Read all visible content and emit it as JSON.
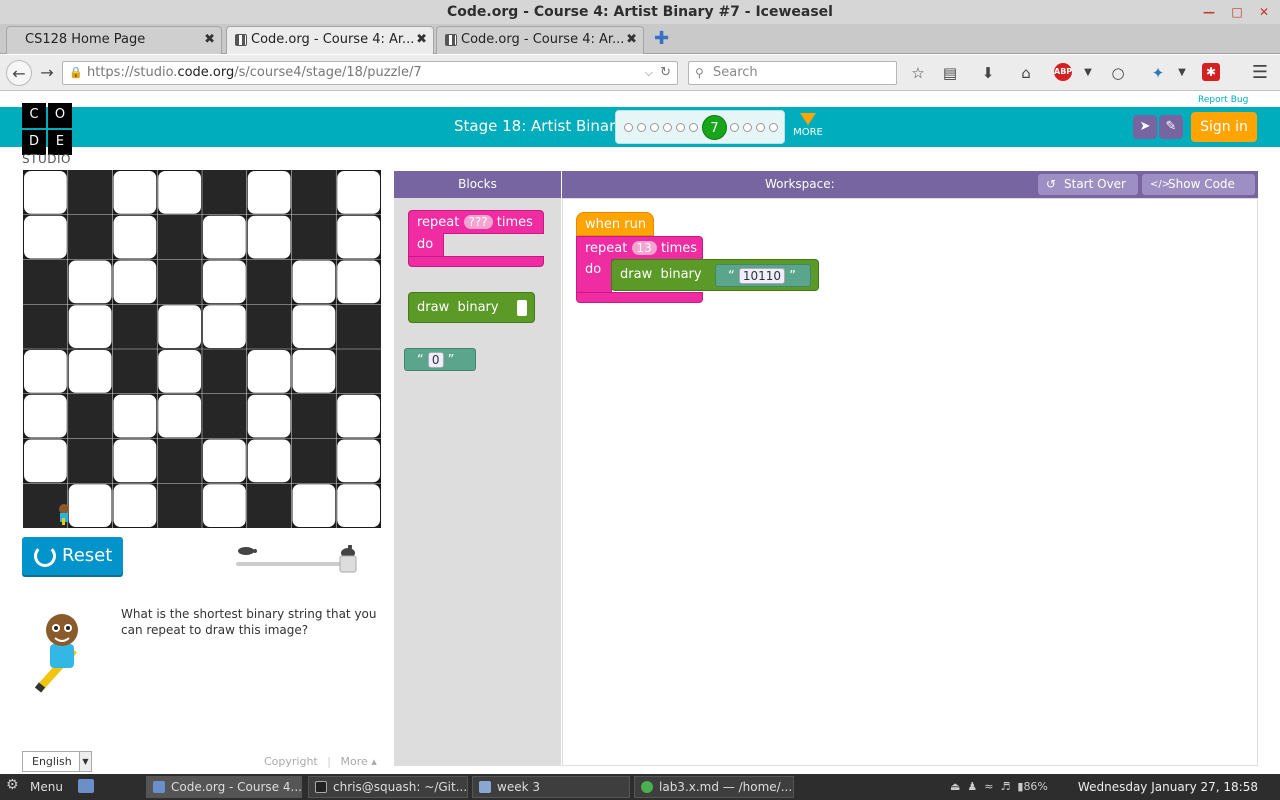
{
  "window": {
    "title": "Code.org - Course 4: Artist Binary #7 - Iceweasel"
  },
  "tabs": [
    {
      "label": "CS128 Home Page",
      "active": false
    },
    {
      "label": "Code.org - Course 4: Ar...",
      "active": true
    },
    {
      "label": "Code.org - Course 4: Ar...",
      "active": false
    }
  ],
  "nav": {
    "url_prefix": "https://studio.",
    "url_domain": "code.org",
    "url_path": "/s/course4/stage/18/puzzle/7",
    "search_placeholder": "Search"
  },
  "site": {
    "logo_letters": [
      "C",
      "O",
      "D",
      "E"
    ],
    "studio_label": "STUDIO",
    "report_bug": "Report Bug",
    "stage_title": "Stage 18: Artist Binary",
    "current_puzzle": "7",
    "more_label": "MORE",
    "sign_in": "Sign in",
    "reset_label": "Reset",
    "instructions": "What is the shortest binary string that you can repeat to draw this image?",
    "language": "English",
    "copyright": "Copyright",
    "more_footer": "More ▴"
  },
  "progress": {
    "dots_before": 6,
    "dots_after": 4
  },
  "artwork": {
    "rows": [
      [
        1,
        0,
        1,
        1,
        0,
        1,
        0,
        1
      ],
      [
        1,
        0,
        1,
        0,
        1,
        1,
        0,
        1
      ],
      [
        0,
        1,
        1,
        0,
        1,
        0,
        1,
        1
      ],
      [
        0,
        1,
        0,
        1,
        1,
        0,
        1,
        0
      ],
      [
        1,
        1,
        0,
        1,
        0,
        1,
        1,
        0
      ],
      [
        1,
        0,
        1,
        1,
        0,
        1,
        0,
        1
      ],
      [
        1,
        0,
        1,
        0,
        1,
        1,
        0,
        1
      ],
      [
        0,
        1,
        1,
        0,
        1,
        0,
        1,
        1
      ]
    ],
    "note": ""
  },
  "toolbox": {
    "header": "Blocks",
    "repeat_label": "repeat",
    "repeat_field": "???",
    "times_label": "times",
    "do_label": "do",
    "draw_label": "draw",
    "binary_label": "binary",
    "string_value": "0"
  },
  "workspace": {
    "header": "Workspace:",
    "start_over": "Start Over",
    "show_code": "Show Code",
    "when_run": "when run",
    "repeat_label": "repeat",
    "repeat_count": "13",
    "times_label": "times",
    "do_label": "do",
    "draw_label": "draw",
    "binary_label": "binary",
    "binary_value": "10110"
  },
  "taskbar": {
    "menu": "Menu",
    "tasks": [
      "Code.org - Course 4...",
      "chris@squash: ~/Git...",
      "week 3",
      "lab3.x.md — /home/..."
    ],
    "battery": "86%",
    "clock": "Wednesday January 27, 18:58"
  },
  "colors": {
    "header_teal": "#00adbc",
    "block_pink": "#f02ca2",
    "block_green": "#5b9a27",
    "block_teal": "#5ba58c",
    "event_orange": "#ffa400",
    "panel_purple": "#7665a0",
    "reset_blue": "#0094ca"
  }
}
